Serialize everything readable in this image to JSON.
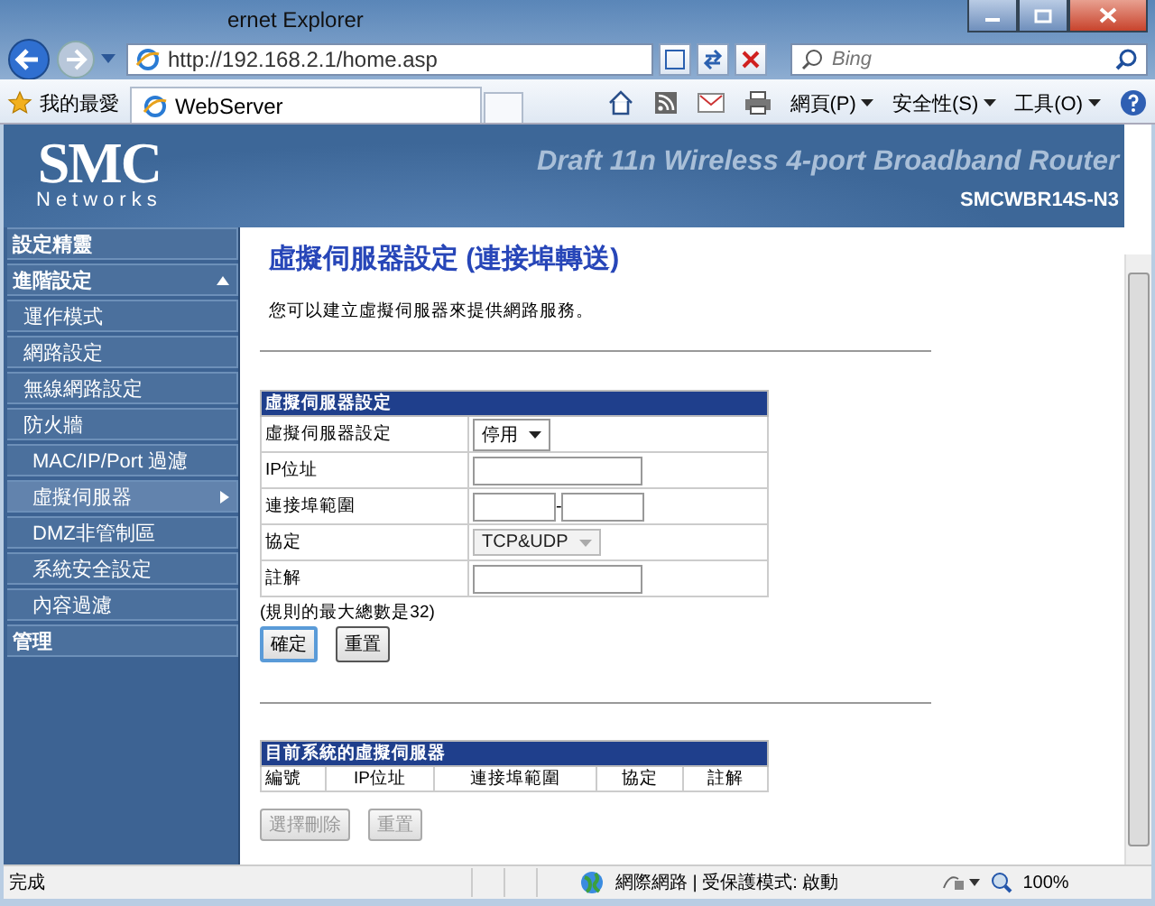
{
  "window": {
    "title": "ernet Explorer"
  },
  "address_bar": {
    "url": "http://192.168.2.1/home.asp"
  },
  "search": {
    "placeholder": "Bing"
  },
  "favorites": {
    "label": "我的最愛"
  },
  "tabs": [
    {
      "label": "WebServer",
      "selected": true
    }
  ],
  "menus": [
    "網頁(P)",
    "安全性(S)",
    "工具(O)"
  ],
  "header": {
    "logo": "SMC",
    "logo_sub": "Networks",
    "product": "Draft 11n Wireless 4-port Broadband Router",
    "model": "SMCWBR14S-N3"
  },
  "sidebar": {
    "items": [
      {
        "label": "設定精靈",
        "selected": false,
        "expanded": false
      },
      {
        "label": "進階設定",
        "selected": false,
        "expanded": true,
        "children": [
          {
            "label": "運作模式",
            "selected": false
          },
          {
            "label": "網路設定",
            "selected": false
          },
          {
            "label": "無線網路設定",
            "selected": false
          },
          {
            "label": "防火牆",
            "selected": false,
            "children": [
              {
                "label": "MAC/IP/Port 過濾",
                "selected": false
              },
              {
                "label": "虛擬伺服器",
                "selected": true
              },
              {
                "label": "DMZ非管制區",
                "selected": false
              },
              {
                "label": "系統安全設定",
                "selected": false
              },
              {
                "label": "內容過濾",
                "selected": false
              }
            ]
          }
        ]
      },
      {
        "label": "管理",
        "selected": false,
        "expanded": false
      }
    ]
  },
  "page": {
    "title": "虛擬伺服器設定 (連接埠轉送)",
    "intro": "您可以建立虛擬伺服器來提供網路服務。",
    "form": {
      "title": "虛擬伺服器設定",
      "rows": [
        {
          "kind": "select",
          "label": "虛擬伺服器設定",
          "value": "停用",
          "disabled": false
        },
        {
          "kind": "text",
          "label": "IP位址"
        },
        {
          "kind": "range",
          "label": "連接埠範圍",
          "separator": "-"
        },
        {
          "kind": "select",
          "label": "協定",
          "value": "TCP&UDP",
          "disabled": true
        },
        {
          "kind": "text",
          "label": "註解"
        }
      ],
      "note": "(規則的最大總數是32)",
      "buttons": [
        {
          "label": "確定",
          "disabled": false,
          "focused": true
        },
        {
          "label": "重置",
          "disabled": false,
          "focused": false
        }
      ]
    },
    "list": {
      "title": "目前系統的虛擬伺服器",
      "columns": [
        "編號",
        "IP位址",
        "連接埠範圍",
        "協定",
        "註解"
      ],
      "buttons": [
        {
          "label": "選擇刪除",
          "disabled": true
        },
        {
          "label": "重置",
          "disabled": true
        }
      ]
    }
  },
  "status_bar": {
    "text": "完成",
    "zone": "網際網路 | 受保護模式: 啟動",
    "zoom": "100%"
  }
}
